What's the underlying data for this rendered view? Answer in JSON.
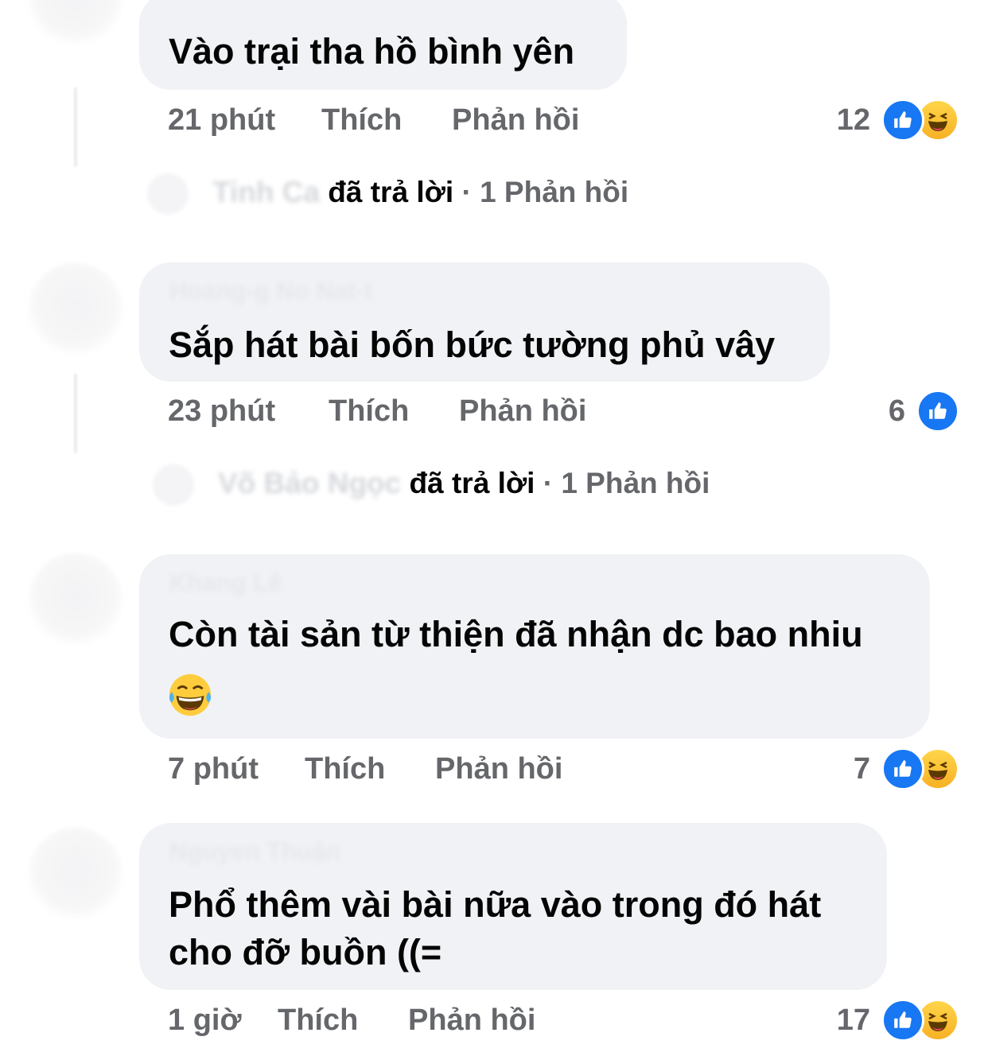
{
  "comments": [
    {
      "author": "",
      "text_lines": [
        "Vào trại tha hồ bình yên"
      ],
      "time": "21 phút",
      "like_label": "Thích",
      "reply_label": "Phản hồi",
      "reaction_count": "12",
      "reactions": [
        "like-icon",
        "haha-icon"
      ],
      "replies": {
        "author": "Tinh Ca",
        "verb": "đã trả lời",
        "count_label": "· 1 Phản hồi"
      }
    },
    {
      "author": "Hoang-g No Nat-t",
      "text_lines": [
        "Sắp hát bài bốn bức tường phủ vây"
      ],
      "time": "23 phút",
      "like_label": "Thích",
      "reply_label": "Phản hồi",
      "reaction_count": "6",
      "reactions": [
        "like-icon"
      ],
      "replies": {
        "author": "Võ Bảo Ngọc",
        "verb": "đã trả lời",
        "count_label": "· 1 Phản hồi"
      }
    },
    {
      "author": "Khang Lê",
      "text_lines": [
        "Còn tài sản từ thiện đã nhận dc bao nhiu"
      ],
      "emoji": "tears-of-joy-emoji",
      "time": "7 phút",
      "like_label": "Thích",
      "reply_label": "Phản hồi",
      "reaction_count": "7",
      "reactions": [
        "like-icon",
        "haha-icon"
      ]
    },
    {
      "author": "Nguyen Thuận",
      "text_lines": [
        "Phổ thêm vài bài nữa vào trong đó hát",
        "cho đỡ buồn ((="
      ],
      "time": "1 giờ",
      "like_label": "Thích",
      "reply_label": "Phản hồi",
      "reaction_count": "17",
      "reactions": [
        "like-icon",
        "haha-icon"
      ]
    }
  ],
  "colors": {
    "bubble": "#f0f2f5",
    "meta": "#65676b",
    "like": "#1877f2",
    "haha": "#f7b125"
  }
}
